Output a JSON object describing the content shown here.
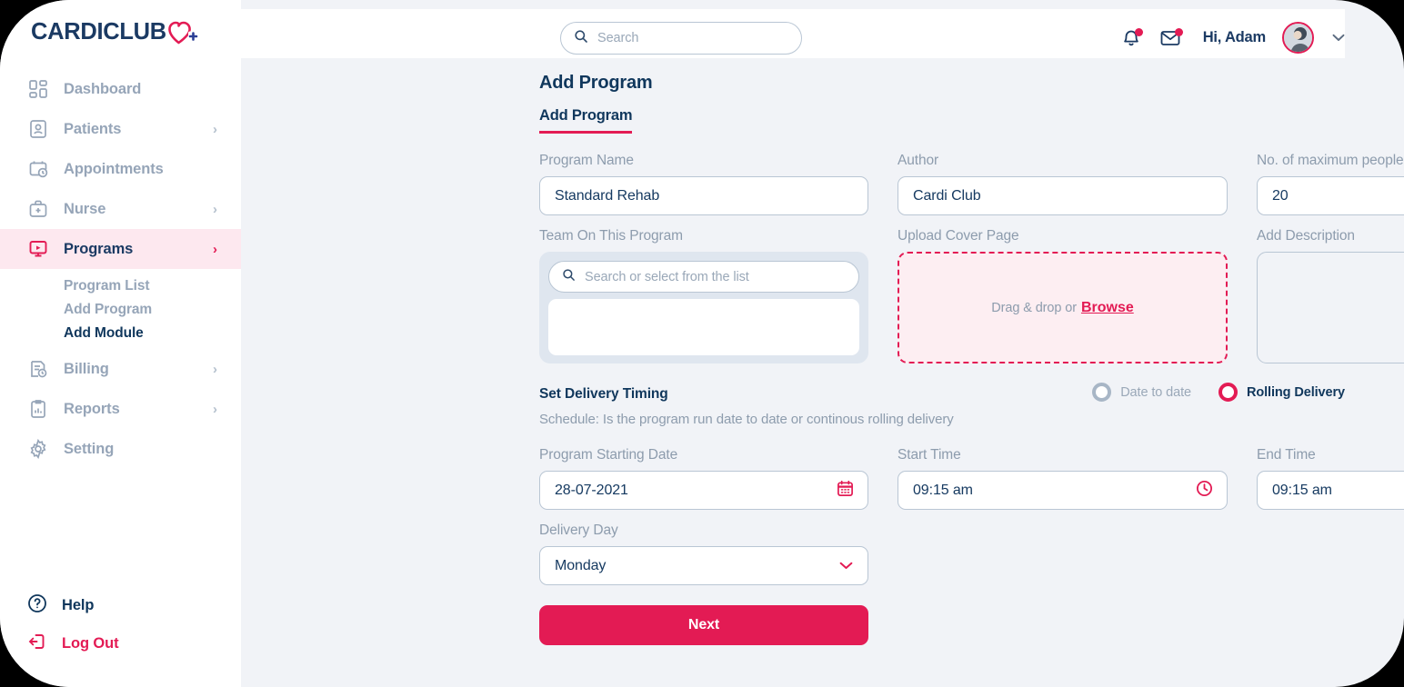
{
  "brand": {
    "name": "CARDICLUB",
    "logo_heart_color": "#e31b54",
    "logo_text_color": "#1b3a63",
    "accent_color": "#e31b54",
    "navy_color": "#10375c"
  },
  "sidebar": {
    "items": [
      {
        "label": "Dashboard",
        "icon": "dashboard-icon",
        "has_chevron": false,
        "active": false
      },
      {
        "label": "Patients",
        "icon": "patients-icon",
        "has_chevron": true,
        "active": false
      },
      {
        "label": "Appointments",
        "icon": "appointments-icon",
        "has_chevron": false,
        "active": false
      },
      {
        "label": "Nurse",
        "icon": "nurse-icon",
        "has_chevron": true,
        "active": false
      },
      {
        "label": "Programs",
        "icon": "programs-icon",
        "has_chevron": true,
        "active": true
      },
      {
        "label": "Billing",
        "icon": "billing-icon",
        "has_chevron": true,
        "active": false
      },
      {
        "label": "Reports",
        "icon": "reports-icon",
        "has_chevron": true,
        "active": false
      },
      {
        "label": "Setting",
        "icon": "gear-icon",
        "has_chevron": false,
        "active": false
      }
    ],
    "sub_items": [
      {
        "label": "Program List",
        "current": false
      },
      {
        "label": "Add Program",
        "current": false
      },
      {
        "label": "Add Module",
        "current": true
      }
    ],
    "chevron_glyph": "›",
    "bottom": {
      "help_label": "Help",
      "help_icon": "question-circle-icon",
      "logout_label": "Log Out",
      "logout_icon": "logout-icon"
    }
  },
  "header": {
    "search_placeholder": "Search",
    "search_value": "",
    "search_icon": "search-icon",
    "notification_icon": "bell-icon",
    "message_icon": "envelope-icon",
    "greeting": "Hi, Adam",
    "avatar_icon": "avatar",
    "caret_icon": "chevron-down-icon",
    "caret_glyph": "⌄"
  },
  "page": {
    "title": "Add Program",
    "tabs": [
      {
        "label": "Add Program",
        "active": true
      }
    ]
  },
  "form": {
    "program_name": {
      "label": "Program Name",
      "value": "Standard Rehab"
    },
    "author": {
      "label": "Author",
      "value": "Cardi Club"
    },
    "max_people": {
      "label": "No. of maximum people",
      "value": "20",
      "icon": "chevron-down-icon"
    },
    "team": {
      "label": "Team On This Program",
      "search_placeholder": "Search or select from the list",
      "search_value": "",
      "search_icon": "search-icon",
      "selected": []
    },
    "upload": {
      "label": "Upload  Cover Page",
      "drag_text": "Drag & drop or",
      "browse_label": "Browse"
    },
    "description": {
      "label": "Add Description",
      "value": ""
    }
  },
  "delivery": {
    "section_title": "Set Delivery Timing",
    "section_subtitle": "Schedule: Is the program run date to date or continous rolling delivery",
    "options": [
      {
        "label": "Date to date",
        "selected": false
      },
      {
        "label": "Rolling Delivery",
        "selected": true
      }
    ],
    "start_date": {
      "label": "Program Starting Date",
      "value": "28-07-2021",
      "icon": "calendar-icon"
    },
    "start_time": {
      "label": "Start Time",
      "value": "09:15 am",
      "icon": "clock-icon"
    },
    "end_time": {
      "label": "End Time",
      "value": "09:15 am",
      "icon": "clock-icon"
    },
    "delivery_day": {
      "label": "Delivery Day",
      "value": "Monday",
      "icon": "chevron-down-icon"
    }
  },
  "actions": {
    "next_label": "Next"
  }
}
